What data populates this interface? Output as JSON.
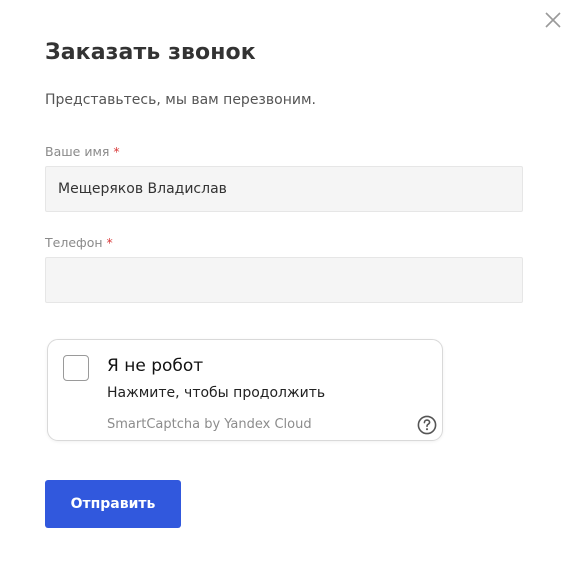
{
  "modal": {
    "title": "Заказать звонок",
    "subtitle": "Представьтесь, мы вам перезвоним.",
    "close_icon": "close-icon"
  },
  "form": {
    "name": {
      "label": "Ваше имя",
      "required_mark": "*",
      "value": "Мещеряков Владислав",
      "placeholder": ""
    },
    "phone": {
      "label": "Телефон",
      "required_mark": "*",
      "value": "",
      "placeholder": ""
    },
    "submit_label": "Отправить"
  },
  "captcha": {
    "title": "Я не робот",
    "subtitle": "Нажмите, чтобы продолжить",
    "brand": "SmartCaptcha by Yandex Cloud",
    "help_icon": "question-circle-icon"
  },
  "colors": {
    "accent": "#3158dd",
    "required": "#d93a3a",
    "field_bg": "#f5f5f5"
  }
}
